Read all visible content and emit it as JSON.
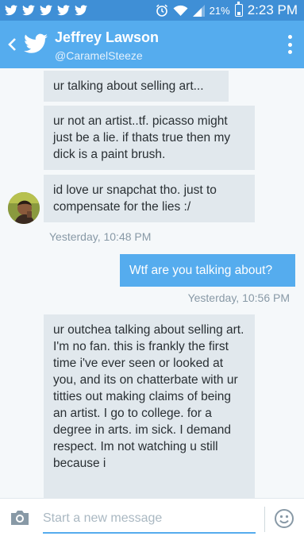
{
  "status_bar": {
    "battery": "21%",
    "time": "2:23 PM",
    "icons": [
      "twitter-icon",
      "twitter-icon",
      "twitter-icon",
      "twitter-icon",
      "twitter-icon",
      "alarm-icon",
      "wifi-icon",
      "signal-icon",
      "battery-icon"
    ]
  },
  "header": {
    "name": "Jeffrey Lawson",
    "handle": "@CaramelSteeze",
    "accent": "#55acee"
  },
  "messages": [
    {
      "direction": "incoming",
      "text": "ur talking about selling art..."
    },
    {
      "direction": "incoming",
      "text": "ur not an artist..tf. picasso might just be a lie. if thats true then my dick is a paint brush."
    },
    {
      "direction": "incoming",
      "text": "id love ur snapchat tho. just to compensate for the lies :/"
    },
    {
      "direction": "outgoing",
      "text": "Wtf are you talking about?"
    },
    {
      "direction": "incoming",
      "text": "ur outchea talking about selling art. I'm no fan. this is frankly the first time i've ever seen or looked at you, and its on chatterbate with ur titties out making claims of being an artist. I go to college. for a degree in arts. im sick. I demand respect. Im not watching u still because i"
    }
  ],
  "timestamps": [
    "Yesterday, 10:48 PM",
    "Yesterday, 10:56 PM"
  ],
  "composer": {
    "placeholder": "Start a new message"
  }
}
